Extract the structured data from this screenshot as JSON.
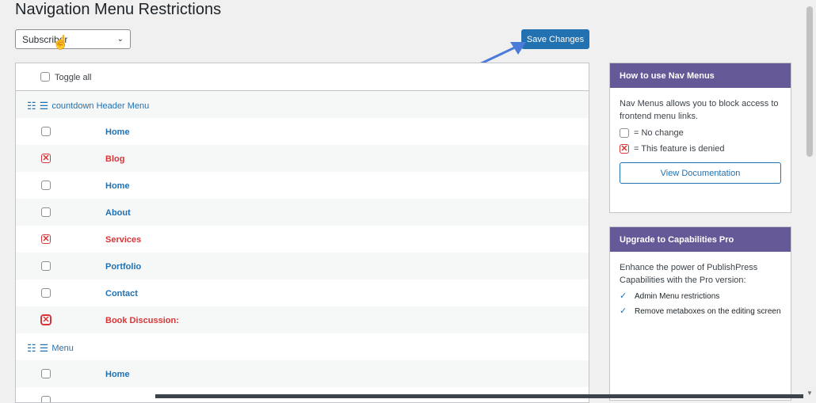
{
  "page": {
    "title": "Navigation Menu Restrictions"
  },
  "role_select": {
    "value": "Subscriber"
  },
  "save_button": "Save Changes",
  "table": {
    "toggle_all": "Toggle all",
    "menus": [
      {
        "name": "countdown Header Menu",
        "items": [
          {
            "label": "Home",
            "denied": false
          },
          {
            "label": "Blog",
            "denied": true
          },
          {
            "label": "Home",
            "denied": false
          },
          {
            "label": "About",
            "denied": false
          },
          {
            "label": "Services",
            "denied": true
          },
          {
            "label": "Portfolio",
            "denied": false
          },
          {
            "label": "Contact",
            "denied": false
          },
          {
            "label": "Book Discussion:",
            "denied": true
          }
        ]
      },
      {
        "name": "Menu",
        "items": [
          {
            "label": "Home",
            "denied": false
          }
        ]
      }
    ]
  },
  "help_box": {
    "title": "How to use Nav Menus",
    "description": "Nav Menus allows you to block access to frontend menu links.",
    "legend_no_change": "= No change",
    "legend_denied": "= This feature is denied",
    "doc_button": "View Documentation"
  },
  "pro_box": {
    "title": "Upgrade to Capabilities Pro",
    "description": "Enhance the power of PublishPress Capabilities with the Pro version:",
    "features": [
      "Admin Menu restrictions",
      "Remove metaboxes on the editing screen"
    ]
  },
  "colors": {
    "accent": "#2271b1",
    "denied": "#d63638",
    "box_header": "#655997",
    "arrow": "#4a7bd8"
  },
  "icons": {
    "menu_icon": "table-list-icon",
    "denied": "x-icon",
    "check": "check-icon",
    "cursor": "hand-pointer-icon"
  }
}
